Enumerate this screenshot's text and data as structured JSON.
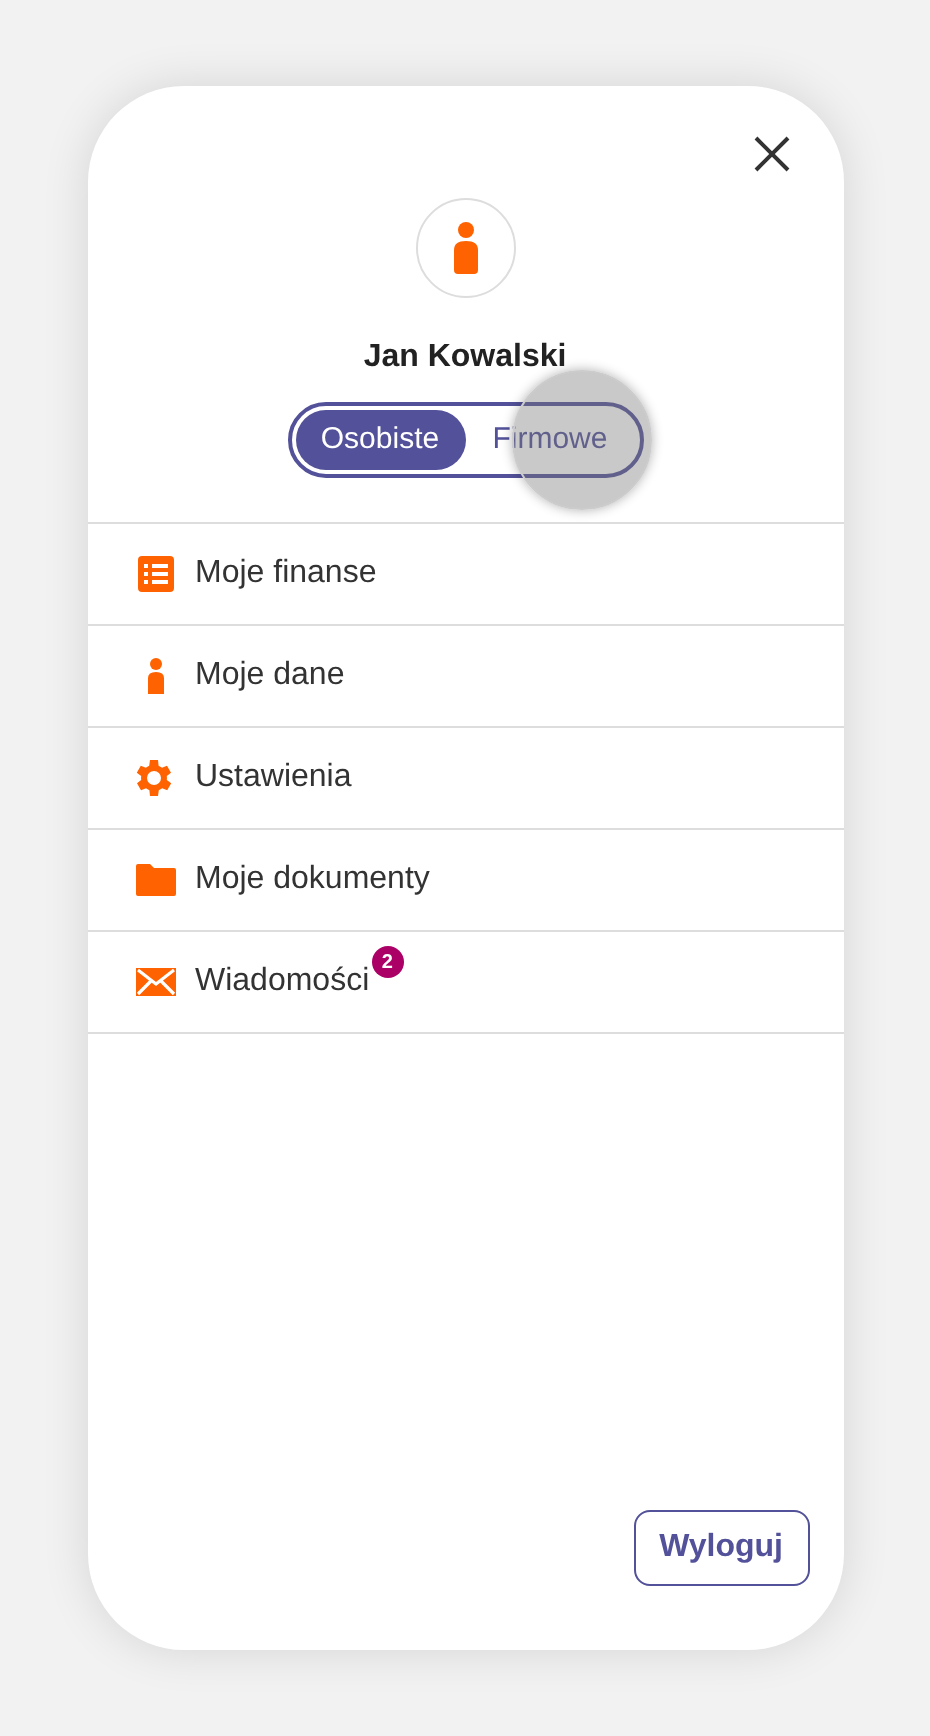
{
  "user": {
    "name": "Jan Kowalski"
  },
  "profile_toggle": [
    {
      "label": "Osobiste",
      "selected": true
    },
    {
      "label": "Firmowe",
      "selected": false
    }
  ],
  "touch_indicator": {
    "kind": "touch"
  },
  "menu": [
    {
      "label": "Moje finanse",
      "kind": "list"
    },
    {
      "label": "Moje dane",
      "kind": "person"
    },
    {
      "label": "Ustawienia",
      "kind": "gear"
    },
    {
      "label": "Moje dokumenty",
      "kind": "folder"
    },
    {
      "label": "Wiadomości",
      "kind": "mail",
      "badge": "2"
    }
  ],
  "logout_button": "Wyloguj"
}
